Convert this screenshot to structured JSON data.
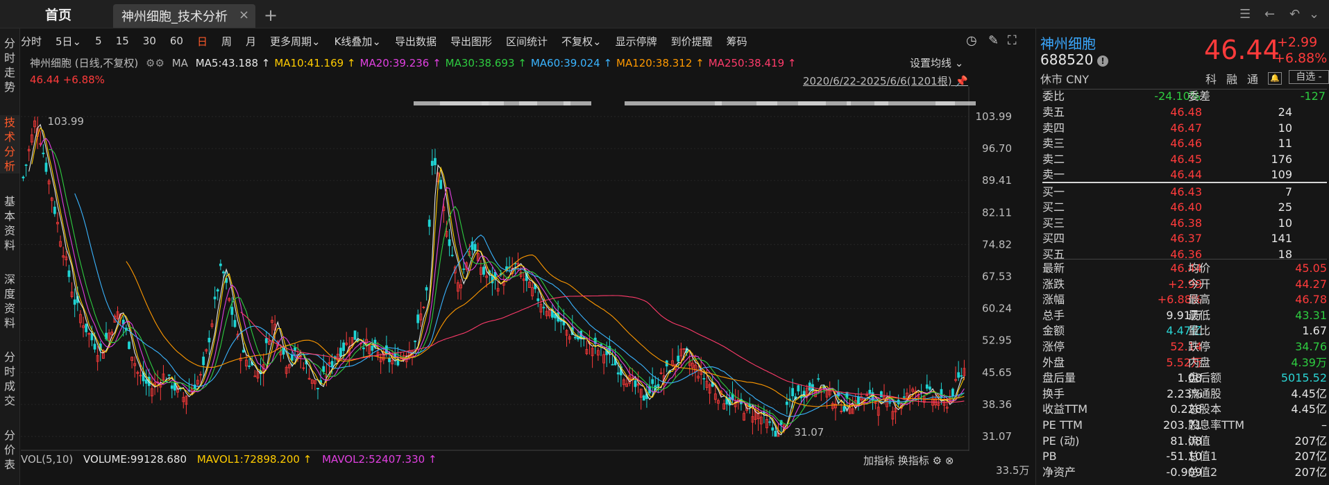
{
  "tabs": {
    "home": "首页",
    "active": "神州细胞_技术分析",
    "close": "×",
    "add": "+"
  },
  "sidenav": [
    {
      "label": "分时走势",
      "active": false
    },
    {
      "label": "技术分析",
      "active": true
    },
    {
      "label": "基本资料",
      "active": false
    },
    {
      "label": "深度资料",
      "active": false
    },
    {
      "label": "分时成交",
      "active": false
    },
    {
      "label": "分价表",
      "active": false
    }
  ],
  "toolbar": [
    {
      "label": "分时",
      "sel": false
    },
    {
      "label": "5日⌄",
      "sel": false
    },
    {
      "label": "5",
      "sel": false
    },
    {
      "label": "15",
      "sel": false
    },
    {
      "label": "30",
      "sel": false
    },
    {
      "label": "60",
      "sel": false
    },
    {
      "label": "日",
      "sel": true
    },
    {
      "label": "周",
      "sel": false
    },
    {
      "label": "月",
      "sel": false
    },
    {
      "label": "更多周期⌄",
      "sel": false
    },
    {
      "label": "K线叠加⌄",
      "sel": false
    },
    {
      "label": "导出数据",
      "sel": false
    },
    {
      "label": "导出图形",
      "sel": false
    },
    {
      "label": "区间统计",
      "sel": false
    },
    {
      "label": "不复权⌄",
      "sel": false
    },
    {
      "label": "显示停牌",
      "sel": false
    },
    {
      "label": "到价提醒",
      "sel": false
    },
    {
      "label": "筹码",
      "sel": false
    }
  ],
  "ma": {
    "title": "神州细胞 (日线,不复权)",
    "ma_label": "MA",
    "items": [
      {
        "text": "MA5:43.188 ↑",
        "color": "#e6e6e6"
      },
      {
        "text": "MA10:41.169 ↑",
        "color": "#ffcc00"
      },
      {
        "text": "MA20:39.236 ↑",
        "color": "#e040e0"
      },
      {
        "text": "MA30:38.693 ↑",
        "color": "#2ecc40"
      },
      {
        "text": "MA60:39.024 ↑",
        "color": "#3ab4ff"
      },
      {
        "text": "MA120:38.312 ↑",
        "color": "#ff9900"
      },
      {
        "text": "MA250:38.419 ↑",
        "color": "#ff3b6b"
      }
    ],
    "price_line": "46.44 +6.88%",
    "set_ma": "设置均线 ⌄",
    "date_range": "2020/6/22-2025/6/6(1201根)"
  },
  "chart_data": {
    "type": "candlestick",
    "y_ticks": [
      "103.99",
      "96.70",
      "89.41",
      "82.11",
      "74.82",
      "67.53",
      "60.24",
      "52.95",
      "45.65",
      "38.36",
      "31.07"
    ],
    "ylim": [
      31.07,
      103.99
    ],
    "high_label": "103.99",
    "low_label": "31.07",
    "close_path": [
      [
        0,
        90
      ],
      [
        2,
        103.99
      ],
      [
        5,
        82
      ],
      [
        8,
        62
      ],
      [
        10,
        55
      ],
      [
        12,
        50
      ],
      [
        15,
        60
      ],
      [
        18,
        45
      ],
      [
        20,
        42
      ],
      [
        22,
        45
      ],
      [
        25,
        40
      ],
      [
        28,
        45
      ],
      [
        31,
        70
      ],
      [
        34,
        50
      ],
      [
        37,
        45
      ],
      [
        39,
        58
      ],
      [
        41,
        48
      ],
      [
        43,
        50
      ],
      [
        46,
        42
      ],
      [
        49,
        50
      ],
      [
        52,
        54
      ],
      [
        55,
        50
      ],
      [
        58,
        48
      ],
      [
        61,
        52
      ],
      [
        63,
        64
      ],
      [
        64,
        96
      ],
      [
        66,
        80
      ],
      [
        68,
        65
      ],
      [
        70,
        75
      ],
      [
        72,
        68
      ],
      [
        74,
        66
      ],
      [
        77,
        70
      ],
      [
        79,
        65
      ],
      [
        82,
        60
      ],
      [
        85,
        55
      ],
      [
        88,
        52
      ],
      [
        91,
        50
      ],
      [
        94,
        45
      ],
      [
        97,
        40
      ],
      [
        100,
        45
      ],
      [
        103,
        50
      ],
      [
        106,
        45
      ],
      [
        109,
        40
      ],
      [
        112,
        38
      ],
      [
        115,
        36
      ],
      [
        118,
        31.07
      ],
      [
        120,
        40
      ],
      [
        124,
        43
      ],
      [
        128,
        38
      ],
      [
        132,
        40
      ],
      [
        136,
        38
      ],
      [
        140,
        42
      ],
      [
        144,
        38
      ],
      [
        147,
        46.44
      ]
    ]
  },
  "vol": {
    "label": "VOL(5,10)",
    "volume": "VOLUME:99128.680",
    "mavol1": "MAVOL1:72898.200 ↑",
    "mavol2": "MAVOL2:52407.330 ↑",
    "add_ind": "加指标",
    "swap_ind": "换指标",
    "scale": "33.5万"
  },
  "stock": {
    "name": "神州细胞",
    "code": "688520",
    "status": "休市 CNY",
    "price": "46.44",
    "change": "+2.99",
    "change_pct": "+6.88%",
    "tags": [
      "科",
      "融",
      "通"
    ],
    "watchlist": "自选 -"
  },
  "weibi": {
    "label": "委比",
    "value": "-24.10%",
    "label2": "委差",
    "value2": "-127"
  },
  "asks": [
    {
      "label": "卖五",
      "price": "46.48",
      "vol": "24"
    },
    {
      "label": "卖四",
      "price": "46.47",
      "vol": "10"
    },
    {
      "label": "卖三",
      "price": "46.46",
      "vol": "11"
    },
    {
      "label": "卖二",
      "price": "46.45",
      "vol": "176"
    },
    {
      "label": "卖一",
      "price": "46.44",
      "vol": "109"
    }
  ],
  "bids": [
    {
      "label": "买一",
      "price": "46.43",
      "vol": "7"
    },
    {
      "label": "买二",
      "price": "46.40",
      "vol": "25"
    },
    {
      "label": "买三",
      "price": "46.38",
      "vol": "10"
    },
    {
      "label": "买四",
      "price": "46.37",
      "vol": "141"
    },
    {
      "label": "买五",
      "price": "46.36",
      "vol": "18"
    }
  ],
  "stats": [
    {
      "l1": "最新",
      "v1": "46.44",
      "c1": "red",
      "l2": "均价",
      "v2": "45.05",
      "c2": "red"
    },
    {
      "l1": "涨跌",
      "v1": "+2.99",
      "c1": "red",
      "l2": "今开",
      "v2": "44.27",
      "c2": "red"
    },
    {
      "l1": "涨幅",
      "v1": "+6.88%",
      "c1": "red",
      "l2": "最高",
      "v2": "46.78",
      "c2": "red"
    },
    {
      "l1": "总手",
      "v1": "9.91万",
      "c1": "white",
      "l2": "最低",
      "v2": "43.31",
      "c2": "green"
    },
    {
      "l1": "金额",
      "v1": "4.47亿",
      "c1": "cyan",
      "l2": "量比",
      "v2": "1.67",
      "c2": "white"
    },
    {
      "l1": "涨停",
      "v1": "52.14",
      "c1": "red",
      "l2": "跌停",
      "v2": "34.76",
      "c2": "green"
    },
    {
      "l1": "外盘",
      "v1": "5.52万",
      "c1": "red",
      "l2": "内盘",
      "v2": "4.39万",
      "c2": "green"
    },
    {
      "l1": "盘后量",
      "v1": "1.08",
      "c1": "white",
      "l2": "盘后额",
      "v2": "5015.52",
      "c2": "cyan"
    },
    {
      "l1": "换手",
      "v1": "2.23%",
      "c1": "white",
      "l2": "流通股",
      "v2": "4.45亿",
      "c2": "white"
    },
    {
      "l1": "收益TTM",
      "v1": "0.228",
      "c1": "white",
      "l2": "总股本",
      "v2": "4.45亿",
      "c2": "white"
    },
    {
      "l1": "PE TTM",
      "v1": "203.71",
      "c1": "white",
      "l2": "股息率TTM",
      "v2": "–",
      "c2": "white"
    },
    {
      "l1": "PE (动)",
      "v1": "81.08",
      "c1": "white",
      "l2": "流值",
      "v2": "207亿",
      "c2": "white"
    },
    {
      "l1": "PB",
      "v1": "-51.10",
      "c1": "white",
      "l2": "总值1",
      "v2": "207亿",
      "c2": "white"
    },
    {
      "l1": "净资产",
      "v1": "-0.909",
      "c1": "white",
      "l2": "总值2",
      "v2": "207亿",
      "c2": "white"
    }
  ]
}
